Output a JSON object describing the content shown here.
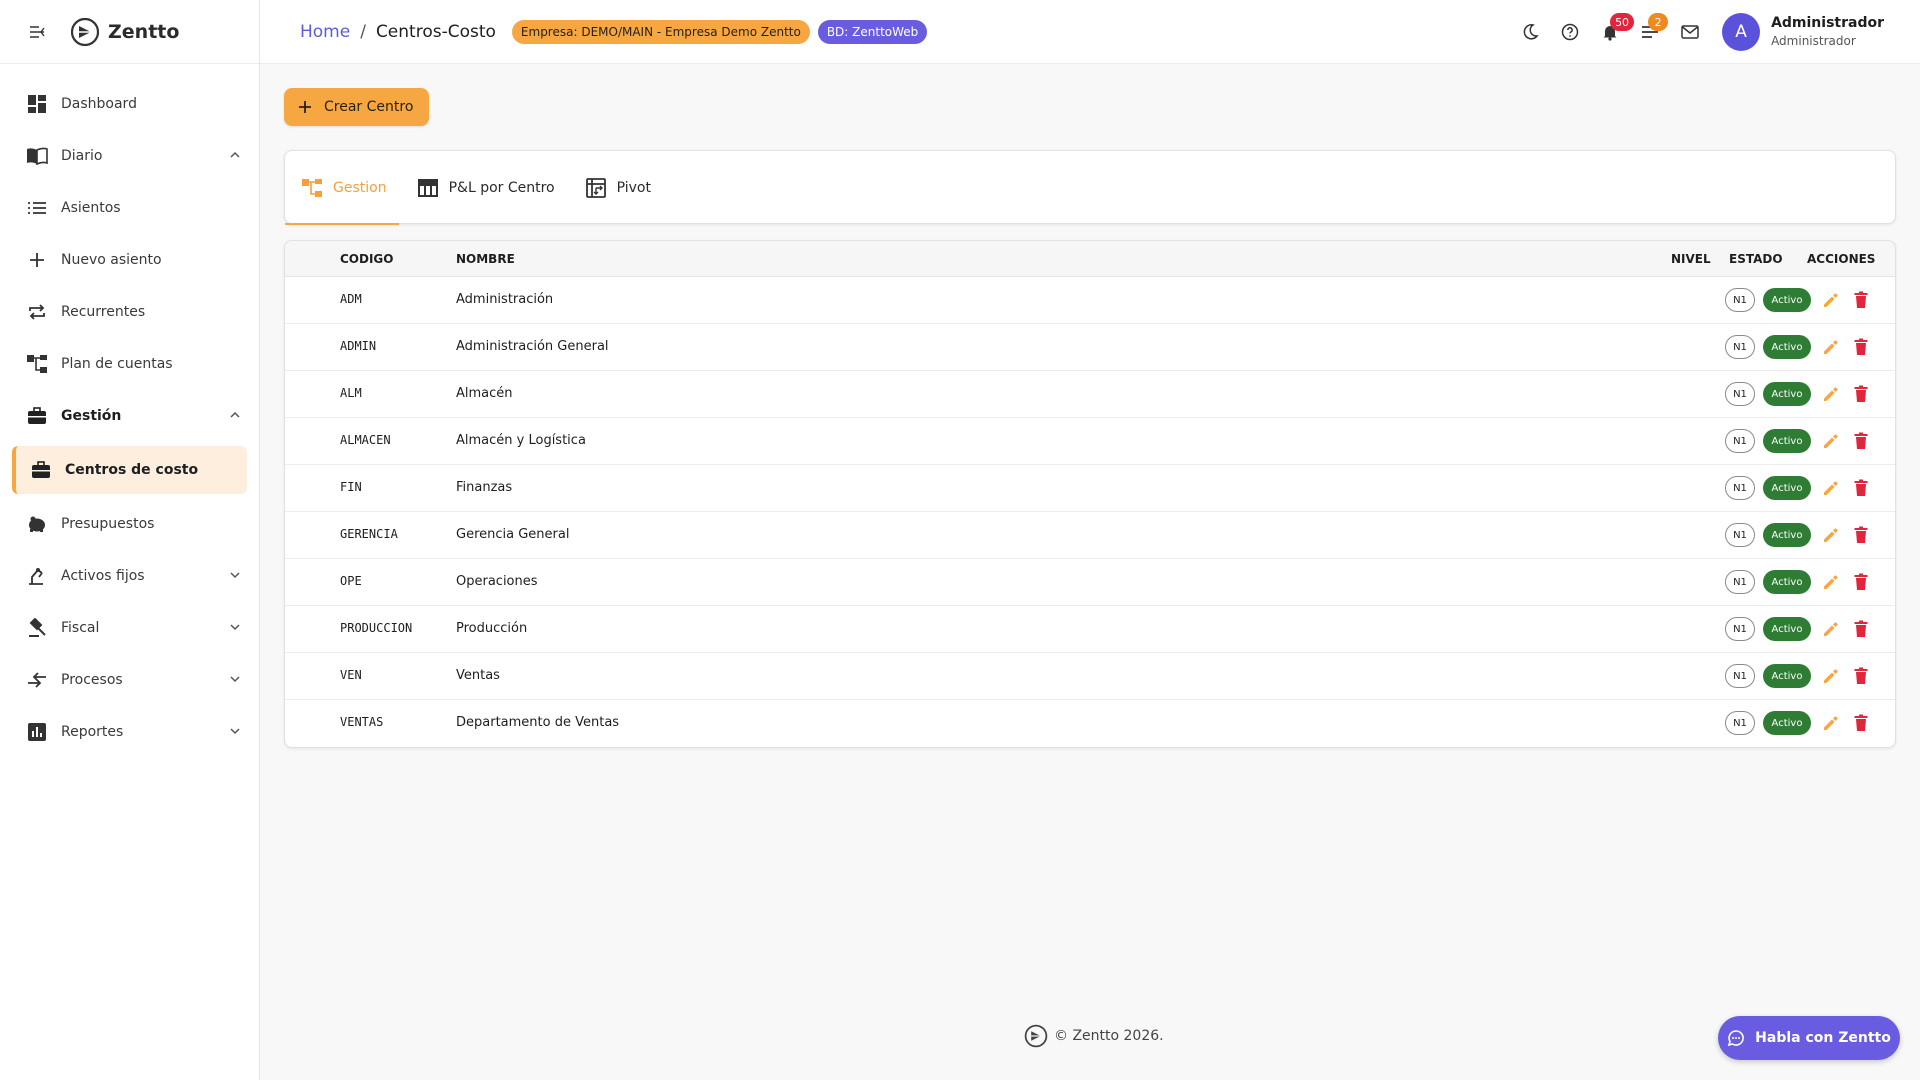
{
  "app": {
    "name": "Zentto"
  },
  "breadcrumb": {
    "home": "Home",
    "separator": "/",
    "current": "Centros-Costo"
  },
  "chips": {
    "company": "Empresa: DEMO/MAIN - Empresa Demo Zentto",
    "db": "BD: ZenttoWeb"
  },
  "header": {
    "notifications_count": "50",
    "tasks_count": "2",
    "user": {
      "avatar_initial": "A",
      "name": "Administrador",
      "role": "Administrador"
    }
  },
  "sidebar": {
    "items": [
      {
        "label": "Dashboard",
        "icon": "dashboard-icon"
      },
      {
        "label": "Diario",
        "icon": "book-icon",
        "expanded": true
      },
      {
        "label": "Asientos",
        "icon": "list-icon"
      },
      {
        "label": "Nuevo asiento",
        "icon": "plus-icon"
      },
      {
        "label": "Recurrentes",
        "icon": "repeat-icon"
      },
      {
        "label": "Plan de cuentas",
        "icon": "tree-icon"
      },
      {
        "label": "Gestión",
        "icon": "briefcase-icon",
        "expanded": true
      },
      {
        "label": "Centros de costo",
        "icon": "briefcase-icon",
        "active": true
      },
      {
        "label": "Presupuestos",
        "icon": "piggy-bank-icon"
      },
      {
        "label": "Activos fijos",
        "icon": "precision-tool-icon",
        "expanded": false
      },
      {
        "label": "Fiscal",
        "icon": "gavel-icon",
        "expanded": false
      },
      {
        "label": "Procesos",
        "icon": "swap-icon",
        "expanded": false
      },
      {
        "label": "Reportes",
        "icon": "bar-chart-icon",
        "expanded": false
      }
    ]
  },
  "toolbar": {
    "create_label": "Crear Centro"
  },
  "tabs": [
    {
      "label": "Gestion",
      "icon": "account-tree-icon",
      "active": true
    },
    {
      "label": "P&L por Centro",
      "icon": "table-icon",
      "active": false
    },
    {
      "label": "Pivot",
      "icon": "pivot-icon",
      "active": false
    }
  ],
  "table": {
    "columns": {
      "code": "CODIGO",
      "name": "NOMBRE",
      "level": "NIVEL",
      "state": "ESTADO",
      "actions": "ACCIONES"
    },
    "rows": [
      {
        "code": "ADM",
        "name": "Administración",
        "level": "N1",
        "state": "Activo"
      },
      {
        "code": "ADMIN",
        "name": "Administración General",
        "level": "N1",
        "state": "Activo"
      },
      {
        "code": "ALM",
        "name": "Almacén",
        "level": "N1",
        "state": "Activo"
      },
      {
        "code": "ALMACEN",
        "name": "Almacén y Logística",
        "level": "N1",
        "state": "Activo"
      },
      {
        "code": "FIN",
        "name": "Finanzas",
        "level": "N1",
        "state": "Activo"
      },
      {
        "code": "GERENCIA",
        "name": "Gerencia General",
        "level": "N1",
        "state": "Activo"
      },
      {
        "code": "OPE",
        "name": "Operaciones",
        "level": "N1",
        "state": "Activo"
      },
      {
        "code": "PRODUCCION",
        "name": "Producción",
        "level": "N1",
        "state": "Activo"
      },
      {
        "code": "VEN",
        "name": "Ventas",
        "level": "N1",
        "state": "Activo"
      },
      {
        "code": "VENTAS",
        "name": "Departamento de Ventas",
        "level": "N1",
        "state": "Activo"
      }
    ]
  },
  "footer": {
    "text": "© Zentto 2026."
  },
  "chat": {
    "label": "Habla con Zentto"
  },
  "colors": {
    "accent": "#f6a742",
    "primary": "#6a5ce0",
    "active_state": "#2f7d35",
    "delete": "#e0253d"
  }
}
